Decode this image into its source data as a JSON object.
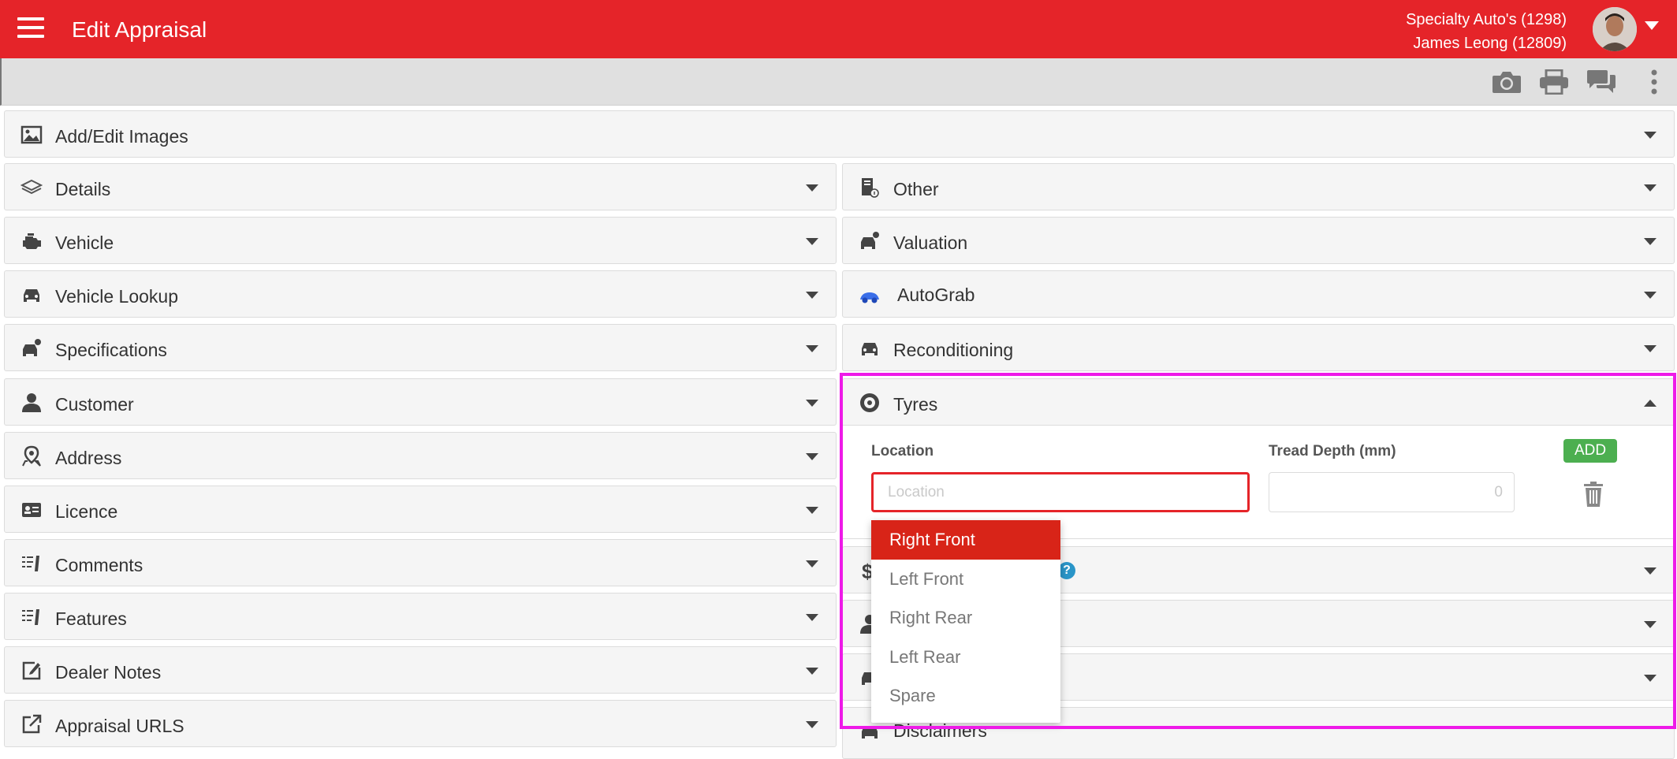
{
  "topbar": {
    "title": "Edit Appraisal",
    "dealer": "Specialty Auto's (1298)",
    "user": "James Leong (12809)",
    "brand_color": "#e52429"
  },
  "toolbar": {
    "icons": [
      "camera-icon",
      "printer-icon",
      "chat-icon",
      "more-vert-icon"
    ]
  },
  "panels": {
    "images": "Add/Edit Images",
    "left": [
      "Details",
      "Vehicle",
      "Vehicle Lookup",
      "Specifications",
      "Customer",
      "Address",
      "Licence",
      "Comments",
      "Features",
      "Dealer Notes",
      "Appraisal URLS"
    ],
    "right_top": [
      "Other",
      "Valuation",
      "AutoGrab",
      "Reconditioning"
    ],
    "tyres": "Tyres",
    "right_bottom_visible": [
      "Disclaimers"
    ]
  },
  "tyres": {
    "location_label": "Location",
    "location_placeholder": "Location",
    "tread_label": "Tread Depth (mm)",
    "tread_placeholder": "0",
    "add_label": "ADD",
    "help_symbol": "?"
  },
  "dropdown": {
    "options": [
      "Right Front",
      "Left Front",
      "Right Rear",
      "Left Rear",
      "Spare"
    ],
    "selected": "Right Front",
    "selected_color": "#d82418"
  },
  "highlight_color": "#ee1ae8"
}
